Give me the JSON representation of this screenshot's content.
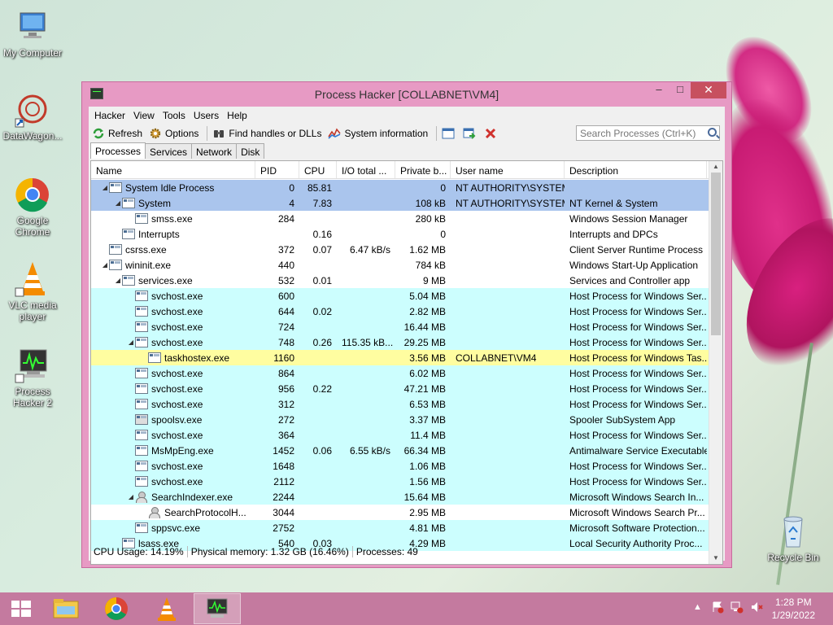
{
  "desktop": {
    "icons": [
      {
        "label": "My Computer",
        "icon": "computer-icon"
      },
      {
        "label": "DataWagon...",
        "icon": "datawagon-icon"
      },
      {
        "label": "Google Chrome",
        "icon": "chrome-icon"
      },
      {
        "label": "VLC media player",
        "icon": "vlc-icon"
      },
      {
        "label": "Process Hacker 2",
        "icon": "process-hacker-icon"
      },
      {
        "label": "Recycle Bin",
        "icon": "recycle-bin-icon"
      }
    ]
  },
  "window": {
    "title": "Process Hacker [COLLABNET\\VM4]",
    "menu": [
      "Hacker",
      "View",
      "Tools",
      "Users",
      "Help"
    ],
    "toolbar": {
      "refresh": "Refresh",
      "options": "Options",
      "find_handles": "Find handles or DLLs",
      "system_info": "System information"
    },
    "search_placeholder": "Search Processes (Ctrl+K)",
    "tabs": [
      "Processes",
      "Services",
      "Network",
      "Disk"
    ],
    "columns": [
      "Name",
      "PID",
      "CPU",
      "I/O total ...",
      "Private b...",
      "User name",
      "Description"
    ],
    "processes": [
      {
        "name": "System Idle Process",
        "pid": "0",
        "cpu": "85.81",
        "io": "",
        "private": "0",
        "user": "NT AUTHORITY\\SYSTEM",
        "desc": "",
        "indent": 0,
        "exp": "◢",
        "style": "sys",
        "icon": "proc"
      },
      {
        "name": "System",
        "pid": "4",
        "cpu": "7.83",
        "io": "",
        "private": "108 kB",
        "user": "NT AUTHORITY\\SYSTEM",
        "desc": "NT Kernel & System",
        "indent": 1,
        "exp": "◢",
        "style": "sys",
        "icon": "proc"
      },
      {
        "name": "smss.exe",
        "pid": "284",
        "cpu": "",
        "io": "",
        "private": "280 kB",
        "user": "",
        "desc": "Windows Session Manager",
        "indent": 2,
        "exp": "",
        "style": "plain",
        "icon": "proc"
      },
      {
        "name": "Interrupts",
        "pid": "",
        "cpu": "0.16",
        "io": "",
        "private": "0",
        "user": "",
        "desc": "Interrupts and DPCs",
        "indent": 1,
        "exp": "",
        "style": "plain",
        "icon": "proc"
      },
      {
        "name": "csrss.exe",
        "pid": "372",
        "cpu": "0.07",
        "io": "6.47 kB/s",
        "private": "1.62 MB",
        "user": "",
        "desc": "Client Server Runtime Process",
        "indent": 0,
        "exp": "",
        "style": "plain",
        "icon": "proc"
      },
      {
        "name": "wininit.exe",
        "pid": "440",
        "cpu": "",
        "io": "",
        "private": "784 kB",
        "user": "",
        "desc": "Windows Start-Up Application",
        "indent": 0,
        "exp": "◢",
        "style": "plain",
        "icon": "proc"
      },
      {
        "name": "services.exe",
        "pid": "532",
        "cpu": "0.01",
        "io": "",
        "private": "9 MB",
        "user": "",
        "desc": "Services and Controller app",
        "indent": 1,
        "exp": "◢",
        "style": "plain",
        "icon": "proc"
      },
      {
        "name": "svchost.exe",
        "pid": "600",
        "cpu": "",
        "io": "",
        "private": "5.04 MB",
        "user": "",
        "desc": "Host Process for Windows Ser...",
        "indent": 2,
        "exp": "",
        "style": "svc",
        "icon": "proc"
      },
      {
        "name": "svchost.exe",
        "pid": "644",
        "cpu": "0.02",
        "io": "",
        "private": "2.82 MB",
        "user": "",
        "desc": "Host Process for Windows Ser...",
        "indent": 2,
        "exp": "",
        "style": "svc",
        "icon": "proc"
      },
      {
        "name": "svchost.exe",
        "pid": "724",
        "cpu": "",
        "io": "",
        "private": "16.44 MB",
        "user": "",
        "desc": "Host Process for Windows Ser...",
        "indent": 2,
        "exp": "",
        "style": "svc",
        "icon": "proc"
      },
      {
        "name": "svchost.exe",
        "pid": "748",
        "cpu": "0.26",
        "io": "115.35 kB...",
        "private": "29.25 MB",
        "user": "",
        "desc": "Host Process for Windows Ser...",
        "indent": 2,
        "exp": "◢",
        "style": "svc",
        "icon": "proc"
      },
      {
        "name": "taskhostex.exe",
        "pid": "1160",
        "cpu": "",
        "io": "",
        "private": "3.56 MB",
        "user": "COLLABNET\\VM4",
        "desc": "Host Process for Windows Tas...",
        "indent": 3,
        "exp": "",
        "style": "sel",
        "icon": "proc"
      },
      {
        "name": "svchost.exe",
        "pid": "864",
        "cpu": "",
        "io": "",
        "private": "6.02 MB",
        "user": "",
        "desc": "Host Process for Windows Ser...",
        "indent": 2,
        "exp": "",
        "style": "svc",
        "icon": "proc"
      },
      {
        "name": "svchost.exe",
        "pid": "956",
        "cpu": "0.22",
        "io": "",
        "private": "47.21 MB",
        "user": "",
        "desc": "Host Process for Windows Ser...",
        "indent": 2,
        "exp": "",
        "style": "svc",
        "icon": "proc"
      },
      {
        "name": "svchost.exe",
        "pid": "312",
        "cpu": "",
        "io": "",
        "private": "6.53 MB",
        "user": "",
        "desc": "Host Process for Windows Ser...",
        "indent": 2,
        "exp": "",
        "style": "svc",
        "icon": "proc"
      },
      {
        "name": "spoolsv.exe",
        "pid": "272",
        "cpu": "",
        "io": "",
        "private": "3.37 MB",
        "user": "",
        "desc": "Spooler SubSystem App",
        "indent": 2,
        "exp": "",
        "style": "svc",
        "icon": "print"
      },
      {
        "name": "svchost.exe",
        "pid": "364",
        "cpu": "",
        "io": "",
        "private": "11.4 MB",
        "user": "",
        "desc": "Host Process for Windows Ser...",
        "indent": 2,
        "exp": "",
        "style": "svc",
        "icon": "proc"
      },
      {
        "name": "MsMpEng.exe",
        "pid": "1452",
        "cpu": "0.06",
        "io": "6.55 kB/s",
        "private": "66.34 MB",
        "user": "",
        "desc": "Antimalware Service Executable",
        "indent": 2,
        "exp": "",
        "style": "svc",
        "icon": "proc"
      },
      {
        "name": "svchost.exe",
        "pid": "1648",
        "cpu": "",
        "io": "",
        "private": "1.06 MB",
        "user": "",
        "desc": "Host Process for Windows Ser...",
        "indent": 2,
        "exp": "",
        "style": "svc",
        "icon": "proc"
      },
      {
        "name": "svchost.exe",
        "pid": "2112",
        "cpu": "",
        "io": "",
        "private": "1.56 MB",
        "user": "",
        "desc": "Host Process for Windows Ser...",
        "indent": 2,
        "exp": "",
        "style": "svc",
        "icon": "proc"
      },
      {
        "name": "SearchIndexer.exe",
        "pid": "2244",
        "cpu": "",
        "io": "",
        "private": "15.64 MB",
        "user": "",
        "desc": "Microsoft Windows Search In...",
        "indent": 2,
        "exp": "◢",
        "style": "svc",
        "icon": "user"
      },
      {
        "name": "SearchProtocolH...",
        "pid": "3044",
        "cpu": "",
        "io": "",
        "private": "2.95 MB",
        "user": "",
        "desc": "Microsoft Windows Search Pr...",
        "indent": 3,
        "exp": "",
        "style": "plain",
        "icon": "user"
      },
      {
        "name": "sppsvc.exe",
        "pid": "2752",
        "cpu": "",
        "io": "",
        "private": "4.81 MB",
        "user": "",
        "desc": "Microsoft Software Protection...",
        "indent": 2,
        "exp": "",
        "style": "svc",
        "icon": "proc"
      },
      {
        "name": "lsass.exe",
        "pid": "540",
        "cpu": "0.03",
        "io": "",
        "private": "4.29 MB",
        "user": "",
        "desc": "Local Security Authority Proc...",
        "indent": 1,
        "exp": "",
        "style": "svc",
        "icon": "proc"
      }
    ],
    "status": {
      "cpu": "CPU Usage: 14.19%",
      "memory": "Physical memory: 1.32 GB (16.46%)",
      "processes": "Processes: 49"
    }
  },
  "taskbar": {
    "time": "1:28 PM",
    "date": "1/29/2022",
    "apps": [
      "file-explorer-icon",
      "chrome-icon",
      "vlc-icon",
      "process-hacker-icon"
    ]
  },
  "colors": {
    "system_row": "#aac5ed",
    "service_row": "#ccfefe",
    "own_process_row": "#fffda0",
    "titlebar": "#e79ac4",
    "close_button": "#c7505f"
  }
}
